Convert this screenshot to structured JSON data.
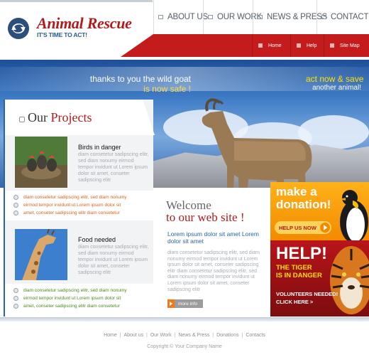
{
  "brand": {
    "title": "Animal Rescue",
    "tagline": "IT'S TIME TO ACT!",
    "colors": {
      "red": "#b31b1b",
      "blue": "#2a63a8",
      "orange": "#f28a00"
    }
  },
  "topnav": {
    "items": [
      {
        "label": "About us",
        "icon": "nav-square-icon"
      },
      {
        "label": "Our work",
        "icon": "nav-square-icon"
      },
      {
        "label": "News & Press",
        "icon": "nav-square-icon"
      },
      {
        "label": "Contact",
        "icon": "nav-square-icon"
      }
    ]
  },
  "subnav": {
    "items": [
      {
        "label": "Home"
      },
      {
        "label": "Help"
      },
      {
        "label": "Site Map"
      }
    ]
  },
  "hero": {
    "left_line1": "thanks to you the wild goat",
    "left_line2": "is now safe !",
    "right_line1": "act now & save",
    "right_line2": "another animal!"
  },
  "projects": {
    "title_our": "Our",
    "title_projects": "Projects",
    "items": [
      {
        "title": "Birds in danger",
        "description": "diam consetetur sadipscing elitr, sed diam nonumy eirmod tempor invidunt ut Lorem ipsum dolor sit amet, conseter sadipscing elitr",
        "bullets": [
          "diam consetetur sadipscing elitr, sed diam nonumy",
          "eirmod tempor invidunt ut Lorem ipsum dolor sit",
          "amet, conseter sadipscing elitr diam consetetur"
        ]
      },
      {
        "title": "Food needed",
        "description": "diam consetetur sadipscing elitr, sed diam nonumy eirmod tempor invidunt ut Lorem ipsum dolor sit amet, conseter sadipscing elitr",
        "bullets": [
          "diam consetetur sadipscing elitr, sed diam nonumy",
          "eirmod tempor invidunt ut Lorem ipsum dolor sit",
          "amet, conseter sadipscing elitr diam consetetur"
        ]
      }
    ]
  },
  "welcome": {
    "line1": "Welcome",
    "line2": "to our web site !",
    "lead": "Lorem ipsum dolor sit amet Lorem dolor sit amet",
    "body": "diam consetetur sadipscing elitr, sed diam nonumy eirmod tempor invidunt ut Lorem ipsum dolor sit amet, conseter sadipscing elitr diam consetetur sadipscing elitr, sed diam nonumy eirmod tempor invidunt ut Lorem ipsum dolor sit amet, conseter sadipscing elitr",
    "more_label": "more info"
  },
  "donate": {
    "line1": "make a",
    "line2": "donation!",
    "button_label": "HELP US NOW"
  },
  "tiger": {
    "help": "HELP!",
    "line1": "THE TIGER",
    "line2": "IS IN DANGER",
    "vol1": "VOLUNTEERS NEEDED!",
    "vol2": "CLICK HERE >"
  },
  "footer": {
    "links": [
      "Home",
      "About us",
      "Our Work",
      "News & Press",
      "Donations",
      "Contacts"
    ],
    "copyright": "Copyright © Your Company Name"
  }
}
